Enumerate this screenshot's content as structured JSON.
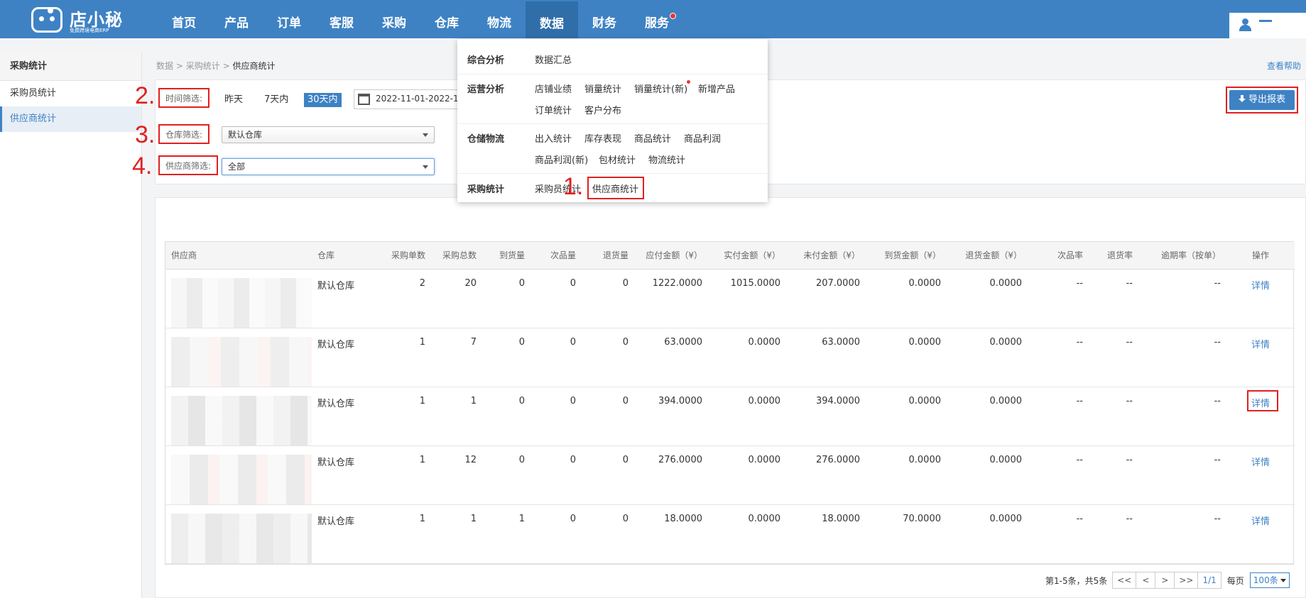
{
  "logo": {
    "name": "店小秘",
    "tagline": "免费跨境电商ERP"
  },
  "nav": [
    {
      "label": "首页"
    },
    {
      "label": "产品"
    },
    {
      "label": "订单"
    },
    {
      "label": "客服"
    },
    {
      "label": "采购"
    },
    {
      "label": "仓库"
    },
    {
      "label": "物流"
    },
    {
      "label": "数据",
      "active": true
    },
    {
      "label": "财务"
    },
    {
      "label": "服务",
      "dot": true
    }
  ],
  "sidebar": {
    "title": "采购统计",
    "items": [
      {
        "label": "采购员统计"
      },
      {
        "label": "供应商统计",
        "active": true
      }
    ]
  },
  "breadcrumb": {
    "a": "数据",
    "b": "采购统计",
    "current": "供应商统计",
    "sep": ">"
  },
  "help_link": "查看帮助",
  "filters": {
    "time_label": "时间筛选:",
    "time_options": [
      "昨天",
      "7天内",
      "30天内"
    ],
    "time_active": "30天内",
    "date_range": "2022-11-01-2022-12",
    "warehouse_label": "仓库筛选:",
    "warehouse_value": "默认仓库",
    "supplier_label": "供应商筛选:",
    "supplier_value": "全部"
  },
  "export_button": "导出报表",
  "steps": {
    "s1": "1.",
    "s2": "2.",
    "s3": "3.",
    "s4": "4."
  },
  "dropdown": {
    "groups": [
      {
        "category": "综合分析",
        "links": [
          "数据汇总"
        ]
      },
      {
        "category": "运营分析",
        "links": [
          "店铺业绩",
          "销量统计",
          "销量统计(新)",
          "新增产品",
          "订单统计",
          "客户分布"
        ]
      },
      {
        "category": "仓储物流",
        "links": [
          "出入统计",
          "库存表现",
          "商品统计",
          "商品利润",
          "商品利润(新)",
          "包材统计",
          "物流统计"
        ]
      },
      {
        "category": "采购统计",
        "links": [
          "采购员统计",
          "供应商统计"
        ]
      }
    ]
  },
  "table": {
    "headers": [
      "供应商",
      "仓库",
      "采购单数",
      "采购总数",
      "到货量",
      "次品量",
      "退货量",
      "应付金额（¥）",
      "实付金额（¥）",
      "未付金额（¥）",
      "到货金额（¥）",
      "退货金额（¥）",
      "次品率",
      "退货率",
      "逾期率（按单）",
      "操作"
    ],
    "rows": [
      {
        "warehouse": "默认仓库",
        "orders": "2",
        "total": "20",
        "arrived": "0",
        "defect": "0",
        "returned": "0",
        "payable": "1222.0000",
        "paid": "1015.0000",
        "unpaid": "207.0000",
        "arrived_amt": "0.0000",
        "return_amt": "0.0000",
        "defect_rate": "--",
        "return_rate": "--",
        "overdue": "--",
        "action": "详情"
      },
      {
        "warehouse": "默认仓库",
        "orders": "1",
        "total": "7",
        "arrived": "0",
        "defect": "0",
        "returned": "0",
        "payable": "63.0000",
        "paid": "0.0000",
        "unpaid": "63.0000",
        "arrived_amt": "0.0000",
        "return_amt": "0.0000",
        "defect_rate": "--",
        "return_rate": "--",
        "overdue": "--",
        "action": "详情"
      },
      {
        "warehouse": "默认仓库",
        "orders": "1",
        "total": "1",
        "arrived": "0",
        "defect": "0",
        "returned": "0",
        "payable": "394.0000",
        "paid": "0.0000",
        "unpaid": "394.0000",
        "arrived_amt": "0.0000",
        "return_amt": "0.0000",
        "defect_rate": "--",
        "return_rate": "--",
        "overdue": "--",
        "action": "详情"
      },
      {
        "warehouse": "默认仓库",
        "orders": "1",
        "total": "12",
        "arrived": "0",
        "defect": "0",
        "returned": "0",
        "payable": "276.0000",
        "paid": "0.0000",
        "unpaid": "276.0000",
        "arrived_amt": "0.0000",
        "return_amt": "0.0000",
        "defect_rate": "--",
        "return_rate": "--",
        "overdue": "--",
        "action": "详情"
      },
      {
        "warehouse": "默认仓库",
        "orders": "1",
        "total": "1",
        "arrived": "1",
        "defect": "0",
        "returned": "0",
        "payable": "18.0000",
        "paid": "0.0000",
        "unpaid": "18.0000",
        "arrived_amt": "70.0000",
        "return_amt": "0.0000",
        "defect_rate": "--",
        "return_rate": "--",
        "overdue": "--",
        "action": "详情"
      }
    ]
  },
  "pager": {
    "summary": "第1-5条，共5条",
    "first": "<<",
    "prev": "<",
    "next": ">",
    "last": ">>",
    "page": "1/1",
    "per_page_label": "每页",
    "per_page": "100条"
  },
  "colors": {
    "primary": "#3e82c4",
    "highlight": "#e02020"
  }
}
